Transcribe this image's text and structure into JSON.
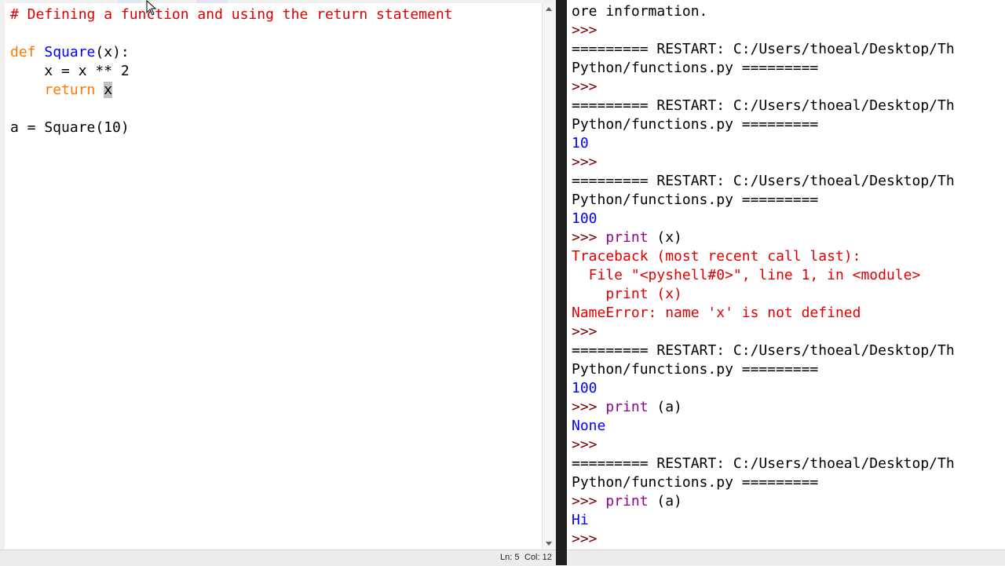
{
  "editor": {
    "lines": [
      [
        {
          "t": "# Defining a function and using the return statement",
          "c": "comment"
        }
      ],
      [
        {
          "t": "",
          "c": "plain"
        }
      ],
      [
        {
          "t": "def",
          "c": "keyword"
        },
        {
          "t": " ",
          "c": "plain"
        },
        {
          "t": "Square",
          "c": "def"
        },
        {
          "t": "(x):",
          "c": "plain"
        }
      ],
      [
        {
          "t": "    x = x ** 2",
          "c": "plain"
        }
      ],
      [
        {
          "t": "    ",
          "c": "plain"
        },
        {
          "t": "return",
          "c": "keyword"
        },
        {
          "t": " ",
          "c": "plain"
        },
        {
          "t": "x",
          "c": "plain",
          "sel": true
        }
      ],
      [
        {
          "t": "",
          "c": "plain"
        }
      ],
      [
        {
          "t": "a = Square(10)",
          "c": "plain"
        }
      ]
    ],
    "status": {
      "line": "Ln: 5",
      "col": "Col: 12"
    }
  },
  "shell": {
    "lines": [
      [
        {
          "t": "ore information.",
          "c": "plain"
        }
      ],
      [
        {
          "t": ">>> ",
          "c": "prompt"
        }
      ],
      [
        {
          "t": "========= RESTART: C:/Users/thoeal/Desktop/Th",
          "c": "restart"
        }
      ],
      [
        {
          "t": "Python/functions.py =========",
          "c": "restart"
        }
      ],
      [
        {
          "t": ">>> ",
          "c": "prompt"
        }
      ],
      [
        {
          "t": "========= RESTART: C:/Users/thoeal/Desktop/Th",
          "c": "restart"
        }
      ],
      [
        {
          "t": "Python/functions.py =========",
          "c": "restart"
        }
      ],
      [
        {
          "t": "10",
          "c": "stdout"
        }
      ],
      [
        {
          "t": ">>> ",
          "c": "prompt"
        }
      ],
      [
        {
          "t": "========= RESTART: C:/Users/thoeal/Desktop/Th",
          "c": "restart"
        }
      ],
      [
        {
          "t": "Python/functions.py =========",
          "c": "restart"
        }
      ],
      [
        {
          "t": "100",
          "c": "stdout"
        }
      ],
      [
        {
          "t": ">>> ",
          "c": "prompt"
        },
        {
          "t": "print",
          "c": "builtin"
        },
        {
          "t": " (x)",
          "c": "plain"
        }
      ],
      [
        {
          "t": "Traceback (most recent call last):",
          "c": "stderr"
        }
      ],
      [
        {
          "t": "  File \"<pyshell#0>\", line 1, in <module>",
          "c": "stderr"
        }
      ],
      [
        {
          "t": "    print (x)",
          "c": "stderr"
        }
      ],
      [
        {
          "t": "NameError: name 'x' is not defined",
          "c": "stderr"
        }
      ],
      [
        {
          "t": ">>> ",
          "c": "prompt"
        }
      ],
      [
        {
          "t": "========= RESTART: C:/Users/thoeal/Desktop/Th",
          "c": "restart"
        }
      ],
      [
        {
          "t": "Python/functions.py =========",
          "c": "restart"
        }
      ],
      [
        {
          "t": "100",
          "c": "stdout"
        }
      ],
      [
        {
          "t": ">>> ",
          "c": "prompt"
        },
        {
          "t": "print",
          "c": "builtin"
        },
        {
          "t": " (a)",
          "c": "plain"
        }
      ],
      [
        {
          "t": "None",
          "c": "stdout"
        }
      ],
      [
        {
          "t": ">>> ",
          "c": "prompt"
        }
      ],
      [
        {
          "t": "========= RESTART: C:/Users/thoeal/Desktop/Th",
          "c": "restart"
        }
      ],
      [
        {
          "t": "Python/functions.py =========",
          "c": "restart"
        }
      ],
      [
        {
          "t": ">>> ",
          "c": "prompt"
        },
        {
          "t": "print",
          "c": "builtin"
        },
        {
          "t": " (a)",
          "c": "plain"
        }
      ],
      [
        {
          "t": "Hi",
          "c": "stdout"
        }
      ],
      [
        {
          "t": ">>> ",
          "c": "prompt"
        }
      ]
    ]
  },
  "icons": {
    "mouse": "mouse-pointer-icon",
    "scroll_up": "arrow-up-icon",
    "scroll_down": "arrow-down-icon"
  },
  "colors": {
    "comment": "#dd0000",
    "keyword": "#ff7700",
    "definition": "#0000ff",
    "builtin": "#900090",
    "stdout": "#0000ff",
    "stderr": "#e00000",
    "prompt": "#770000"
  }
}
